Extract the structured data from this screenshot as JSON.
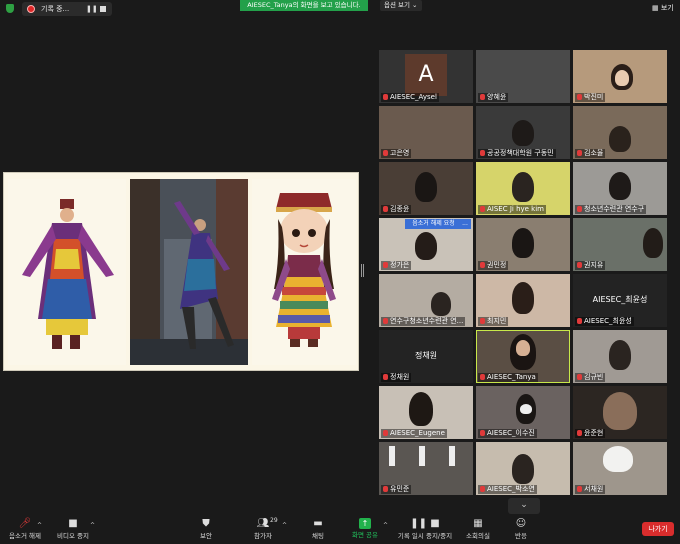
{
  "topbar": {
    "recording_label": "기록 중...",
    "share_banner": "AIESEC_Tanya의 화면을 보고 있습니다.",
    "view_options": "옵션 보기 ⌄",
    "grid_view": "보기"
  },
  "participants": [
    {
      "name": "AIESEC_Aysel",
      "initial": "A"
    },
    {
      "name": "양혜윤"
    },
    {
      "name": "박진미"
    },
    {
      "name": "고은영"
    },
    {
      "name": "공공정책대학원 구동민"
    },
    {
      "name": "김소율"
    },
    {
      "name": "김종윤"
    },
    {
      "name": "AISEC Ji hye kim"
    },
    {
      "name": "청소년수련관 연수구"
    },
    {
      "name": "정가은"
    },
    {
      "name": "권민정"
    },
    {
      "name": "권지유"
    },
    {
      "name": "연수구청소년수련관 연..."
    },
    {
      "name": "최지민"
    },
    {
      "name": "AIESEC_최윤성",
      "center": "AIESEC_최윤성"
    },
    {
      "name": "정채원",
      "center": "정채원"
    },
    {
      "name": "AIESEC_Tanya"
    },
    {
      "name": "김규빈"
    },
    {
      "name": "AIESEC_Eugene"
    },
    {
      "name": "AIESEC_이수진"
    },
    {
      "name": "윤준현"
    },
    {
      "name": "유민준"
    },
    {
      "name": "AIESEC_박소연"
    },
    {
      "name": "서채원"
    }
  ],
  "grid": {
    "unmute_request": "음소거 해제 요청",
    "more": "...",
    "scroll_down": "⌄"
  },
  "toolbar": {
    "mute": "음소거 해제",
    "video": "비디오 중지",
    "security": "보안",
    "participants": "참가자",
    "participants_count": "29",
    "chat": "채팅",
    "share": "화면 공유",
    "pause_recording": "기록 일시 중지/중지",
    "breakout": "소회의실",
    "reactions": "반응",
    "leave": "나가기"
  }
}
